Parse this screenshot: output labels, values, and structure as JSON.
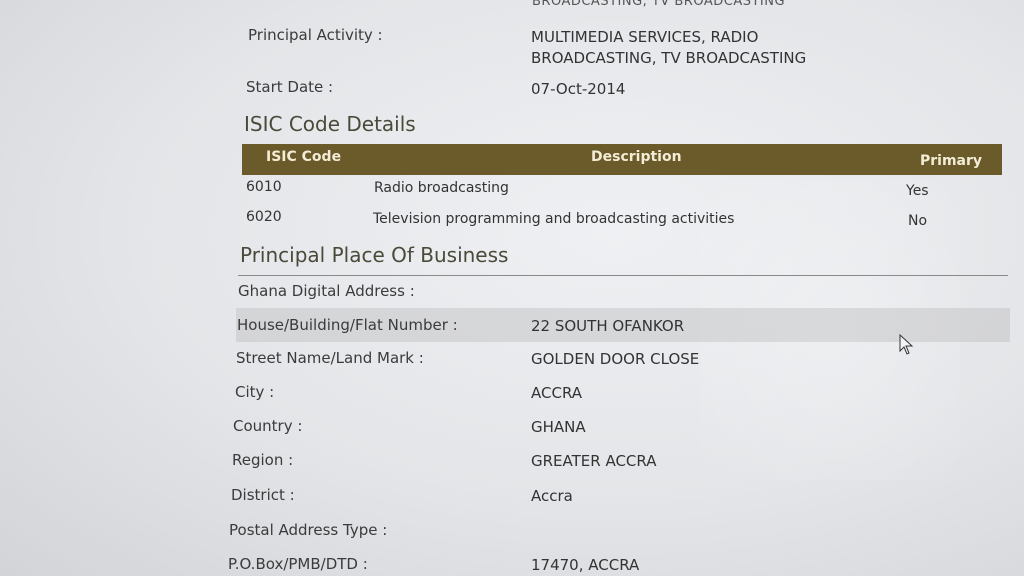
{
  "top_cut_text": "BROADCASTING, TV BROADCASTING",
  "principal_activity": {
    "label": "Principal Activity :",
    "value_line1": "MULTIMEDIA SERVICES, RADIO",
    "value_line2": "BROADCASTING, TV BROADCASTING"
  },
  "start_date": {
    "label": "Start Date :",
    "value": "07-Oct-2014"
  },
  "isic": {
    "title": "ISIC Code Details",
    "headers": {
      "code": "ISIC Code",
      "description": "Description",
      "primary": "Primary"
    },
    "rows": [
      {
        "code": "6010",
        "description": "Radio broadcasting",
        "primary": "Yes"
      },
      {
        "code": "6020",
        "description": "Television programming and broadcasting activities",
        "primary": "No"
      }
    ]
  },
  "business": {
    "title": "Principal Place Of Business",
    "fields": [
      {
        "label": "Ghana Digital Address :",
        "value": ""
      },
      {
        "label": "House/Building/Flat Number :",
        "value": "22 SOUTH OFANKOR"
      },
      {
        "label": "Street Name/Land Mark :",
        "value": "GOLDEN DOOR CLOSE"
      },
      {
        "label": "City :",
        "value": "ACCRA"
      },
      {
        "label": "Country :",
        "value": "GHANA"
      },
      {
        "label": "Region :",
        "value": "GREATER ACCRA"
      },
      {
        "label": "District :",
        "value": "Accra"
      },
      {
        "label": "Postal Address Type :",
        "value": ""
      },
      {
        "label": "P.O.Box/PMB/DTD :",
        "value": "17470, ACCRA"
      }
    ]
  }
}
